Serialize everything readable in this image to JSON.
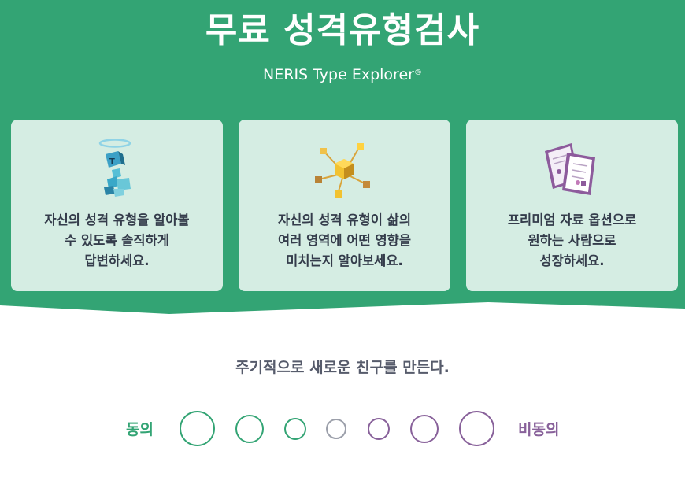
{
  "colors": {
    "brand_green": "#33a474",
    "card_bg": "#d5ede3",
    "purple": "#88619a",
    "neutral": "#9b9faa"
  },
  "header": {
    "title": "무료 성격유형검사",
    "subtitle": "NERIS Type Explorer",
    "subtitle_mark": "®"
  },
  "cards": [
    {
      "icon": "cube-figure-icon",
      "lines": [
        "자신의 성격 유형을 알아볼",
        "수 있도록 솔직하게",
        "답변하세요."
      ]
    },
    {
      "icon": "cube-network-icon",
      "lines": [
        "자신의 성격 유형이 삶의",
        "여러 영역에 어떤 영향을",
        "미치는지 알아보세요."
      ]
    },
    {
      "icon": "documents-icon",
      "lines": [
        "프리미엄 자료 옵션으로",
        "원하는 사람으로",
        "성장하세요."
      ]
    }
  ],
  "question": {
    "text": "주기적으로 새로운 친구를 만든다.",
    "agree_label": "동의",
    "disagree_label": "비동의",
    "options_count": 7
  }
}
